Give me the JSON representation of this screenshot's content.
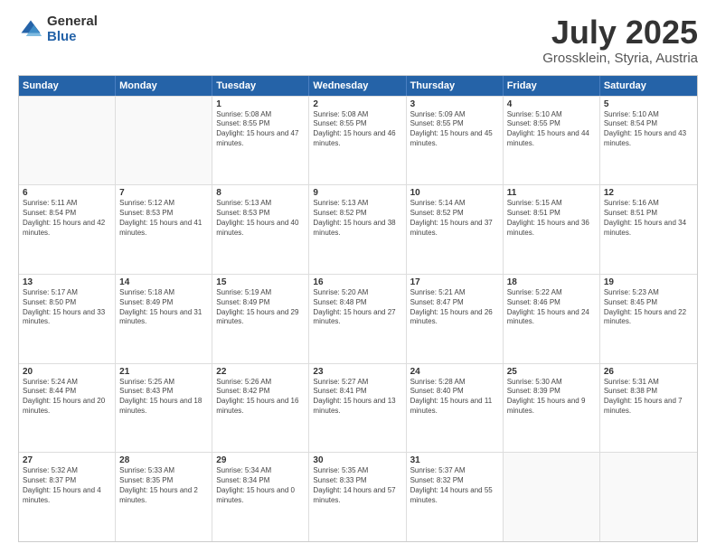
{
  "logo": {
    "general": "General",
    "blue": "Blue"
  },
  "title": "July 2025",
  "subtitle": "Grossklein, Styria, Austria",
  "header_days": [
    "Sunday",
    "Monday",
    "Tuesday",
    "Wednesday",
    "Thursday",
    "Friday",
    "Saturday"
  ],
  "rows": [
    [
      {
        "day": "",
        "sunrise": "",
        "sunset": "",
        "daylight": "",
        "empty": true
      },
      {
        "day": "",
        "sunrise": "",
        "sunset": "",
        "daylight": "",
        "empty": true
      },
      {
        "day": "1",
        "sunrise": "Sunrise: 5:08 AM",
        "sunset": "Sunset: 8:55 PM",
        "daylight": "Daylight: 15 hours and 47 minutes."
      },
      {
        "day": "2",
        "sunrise": "Sunrise: 5:08 AM",
        "sunset": "Sunset: 8:55 PM",
        "daylight": "Daylight: 15 hours and 46 minutes."
      },
      {
        "day": "3",
        "sunrise": "Sunrise: 5:09 AM",
        "sunset": "Sunset: 8:55 PM",
        "daylight": "Daylight: 15 hours and 45 minutes."
      },
      {
        "day": "4",
        "sunrise": "Sunrise: 5:10 AM",
        "sunset": "Sunset: 8:55 PM",
        "daylight": "Daylight: 15 hours and 44 minutes."
      },
      {
        "day": "5",
        "sunrise": "Sunrise: 5:10 AM",
        "sunset": "Sunset: 8:54 PM",
        "daylight": "Daylight: 15 hours and 43 minutes."
      }
    ],
    [
      {
        "day": "6",
        "sunrise": "Sunrise: 5:11 AM",
        "sunset": "Sunset: 8:54 PM",
        "daylight": "Daylight: 15 hours and 42 minutes."
      },
      {
        "day": "7",
        "sunrise": "Sunrise: 5:12 AM",
        "sunset": "Sunset: 8:53 PM",
        "daylight": "Daylight: 15 hours and 41 minutes."
      },
      {
        "day": "8",
        "sunrise": "Sunrise: 5:13 AM",
        "sunset": "Sunset: 8:53 PM",
        "daylight": "Daylight: 15 hours and 40 minutes."
      },
      {
        "day": "9",
        "sunrise": "Sunrise: 5:13 AM",
        "sunset": "Sunset: 8:52 PM",
        "daylight": "Daylight: 15 hours and 38 minutes."
      },
      {
        "day": "10",
        "sunrise": "Sunrise: 5:14 AM",
        "sunset": "Sunset: 8:52 PM",
        "daylight": "Daylight: 15 hours and 37 minutes."
      },
      {
        "day": "11",
        "sunrise": "Sunrise: 5:15 AM",
        "sunset": "Sunset: 8:51 PM",
        "daylight": "Daylight: 15 hours and 36 minutes."
      },
      {
        "day": "12",
        "sunrise": "Sunrise: 5:16 AM",
        "sunset": "Sunset: 8:51 PM",
        "daylight": "Daylight: 15 hours and 34 minutes."
      }
    ],
    [
      {
        "day": "13",
        "sunrise": "Sunrise: 5:17 AM",
        "sunset": "Sunset: 8:50 PM",
        "daylight": "Daylight: 15 hours and 33 minutes."
      },
      {
        "day": "14",
        "sunrise": "Sunrise: 5:18 AM",
        "sunset": "Sunset: 8:49 PM",
        "daylight": "Daylight: 15 hours and 31 minutes."
      },
      {
        "day": "15",
        "sunrise": "Sunrise: 5:19 AM",
        "sunset": "Sunset: 8:49 PM",
        "daylight": "Daylight: 15 hours and 29 minutes."
      },
      {
        "day": "16",
        "sunrise": "Sunrise: 5:20 AM",
        "sunset": "Sunset: 8:48 PM",
        "daylight": "Daylight: 15 hours and 27 minutes."
      },
      {
        "day": "17",
        "sunrise": "Sunrise: 5:21 AM",
        "sunset": "Sunset: 8:47 PM",
        "daylight": "Daylight: 15 hours and 26 minutes."
      },
      {
        "day": "18",
        "sunrise": "Sunrise: 5:22 AM",
        "sunset": "Sunset: 8:46 PM",
        "daylight": "Daylight: 15 hours and 24 minutes."
      },
      {
        "day": "19",
        "sunrise": "Sunrise: 5:23 AM",
        "sunset": "Sunset: 8:45 PM",
        "daylight": "Daylight: 15 hours and 22 minutes."
      }
    ],
    [
      {
        "day": "20",
        "sunrise": "Sunrise: 5:24 AM",
        "sunset": "Sunset: 8:44 PM",
        "daylight": "Daylight: 15 hours and 20 minutes."
      },
      {
        "day": "21",
        "sunrise": "Sunrise: 5:25 AM",
        "sunset": "Sunset: 8:43 PM",
        "daylight": "Daylight: 15 hours and 18 minutes."
      },
      {
        "day": "22",
        "sunrise": "Sunrise: 5:26 AM",
        "sunset": "Sunset: 8:42 PM",
        "daylight": "Daylight: 15 hours and 16 minutes."
      },
      {
        "day": "23",
        "sunrise": "Sunrise: 5:27 AM",
        "sunset": "Sunset: 8:41 PM",
        "daylight": "Daylight: 15 hours and 13 minutes."
      },
      {
        "day": "24",
        "sunrise": "Sunrise: 5:28 AM",
        "sunset": "Sunset: 8:40 PM",
        "daylight": "Daylight: 15 hours and 11 minutes."
      },
      {
        "day": "25",
        "sunrise": "Sunrise: 5:30 AM",
        "sunset": "Sunset: 8:39 PM",
        "daylight": "Daylight: 15 hours and 9 minutes."
      },
      {
        "day": "26",
        "sunrise": "Sunrise: 5:31 AM",
        "sunset": "Sunset: 8:38 PM",
        "daylight": "Daylight: 15 hours and 7 minutes."
      }
    ],
    [
      {
        "day": "27",
        "sunrise": "Sunrise: 5:32 AM",
        "sunset": "Sunset: 8:37 PM",
        "daylight": "Daylight: 15 hours and 4 minutes."
      },
      {
        "day": "28",
        "sunrise": "Sunrise: 5:33 AM",
        "sunset": "Sunset: 8:35 PM",
        "daylight": "Daylight: 15 hours and 2 minutes."
      },
      {
        "day": "29",
        "sunrise": "Sunrise: 5:34 AM",
        "sunset": "Sunset: 8:34 PM",
        "daylight": "Daylight: 15 hours and 0 minutes."
      },
      {
        "day": "30",
        "sunrise": "Sunrise: 5:35 AM",
        "sunset": "Sunset: 8:33 PM",
        "daylight": "Daylight: 14 hours and 57 minutes."
      },
      {
        "day": "31",
        "sunrise": "Sunrise: 5:37 AM",
        "sunset": "Sunset: 8:32 PM",
        "daylight": "Daylight: 14 hours and 55 minutes."
      },
      {
        "day": "",
        "sunrise": "",
        "sunset": "",
        "daylight": "",
        "empty": true
      },
      {
        "day": "",
        "sunrise": "",
        "sunset": "",
        "daylight": "",
        "empty": true
      }
    ]
  ]
}
